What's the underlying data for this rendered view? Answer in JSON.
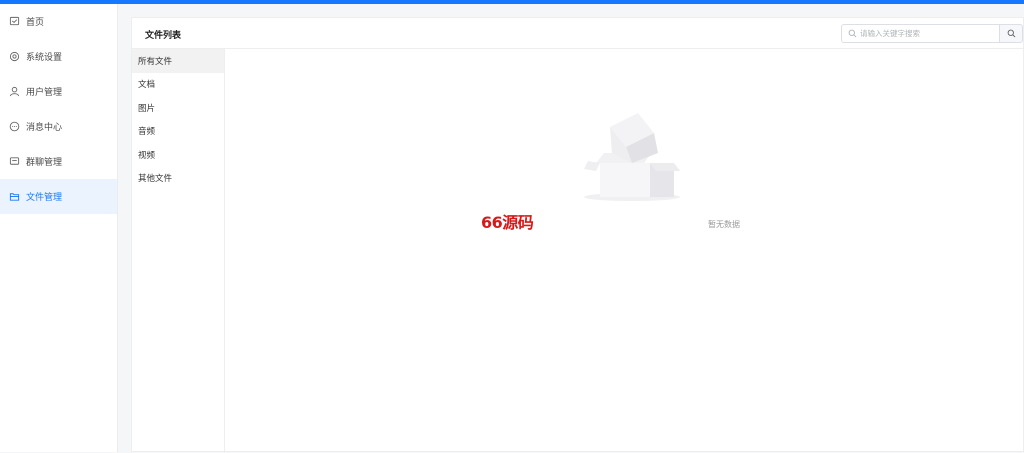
{
  "sidebar": {
    "items": [
      {
        "label": "首页",
        "icon": "home-icon"
      },
      {
        "label": "系统设置",
        "icon": "gear-icon"
      },
      {
        "label": "用户管理",
        "icon": "user-icon"
      },
      {
        "label": "消息中心",
        "icon": "message-icon"
      },
      {
        "label": "群聊管理",
        "icon": "chat-icon"
      },
      {
        "label": "文件管理",
        "icon": "folder-icon",
        "active": true
      }
    ]
  },
  "main": {
    "title": "文件列表",
    "search": {
      "placeholder": "请输入关键字搜索",
      "value": ""
    },
    "categories": [
      {
        "label": "所有文件",
        "active": true
      },
      {
        "label": "文档"
      },
      {
        "label": "图片"
      },
      {
        "label": "音频"
      },
      {
        "label": "视频"
      },
      {
        "label": "其他文件"
      }
    ],
    "empty_text": "暂无数据"
  },
  "watermark": "66源码",
  "colors": {
    "accent": "#1677ff",
    "active_bg": "#ebf3ff",
    "watermark": "#d61a1a"
  }
}
